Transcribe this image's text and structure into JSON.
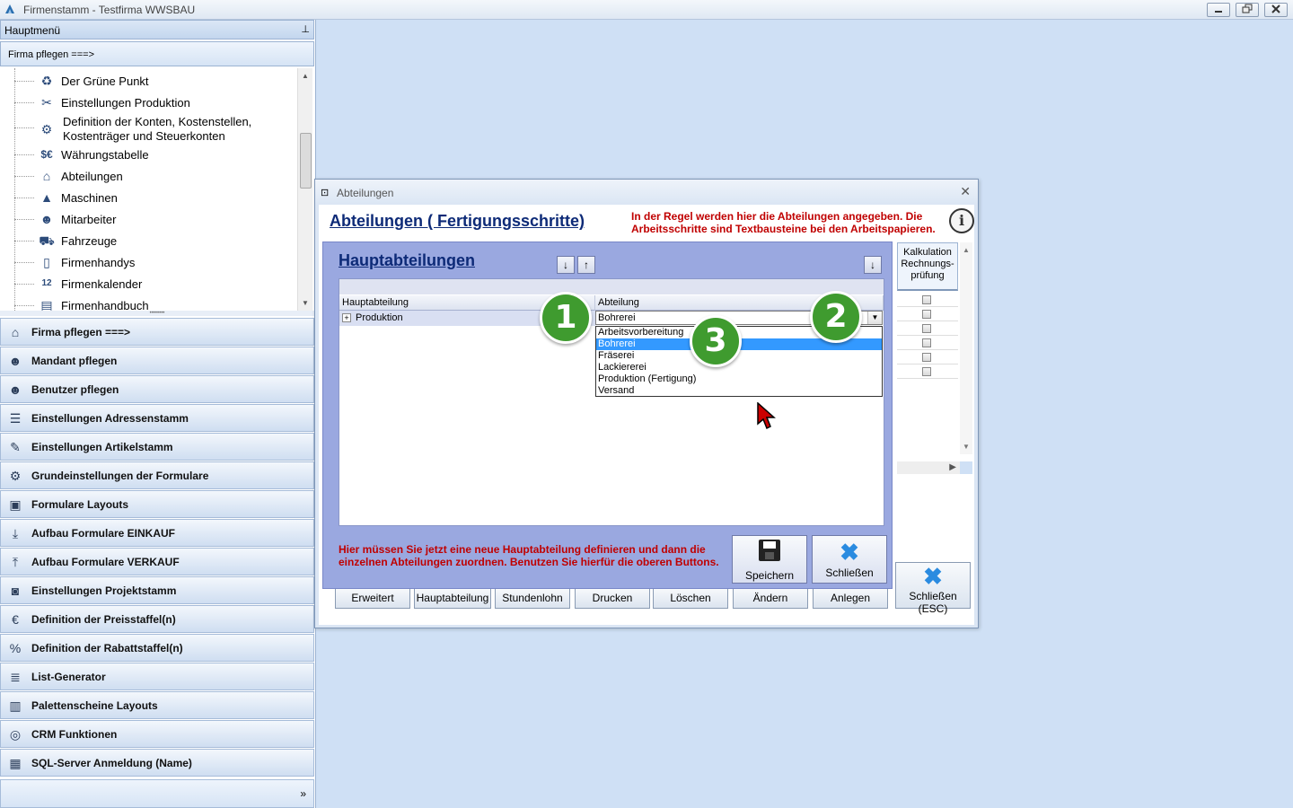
{
  "window": {
    "title": "Firmenstamm - Testfirma WWSBAU",
    "min": "▭",
    "restore": "⧉",
    "close": "✕"
  },
  "left_panel": {
    "header": "Hauptmenü",
    "pin": "⊥",
    "subheader": "Firma pflegen    ===>",
    "tree_items": [
      {
        "label": "Der Grüne Punkt",
        "icon": "recycle-icon",
        "glyph": "♻"
      },
      {
        "label": "Einstellungen Produktion",
        "icon": "tools-icon",
        "glyph": "✂"
      },
      {
        "label": "Definition der Konten, Kostenstellen,",
        "label2": "Kostenträger und Steuerkonten",
        "icon": "accounts-icon",
        "glyph": "⚙"
      },
      {
        "label": "Währungstabelle",
        "icon": "currency-icon",
        "glyph": "$€"
      },
      {
        "label": "Abteilungen",
        "icon": "departments-icon",
        "glyph": "⌂"
      },
      {
        "label": "Maschinen",
        "icon": "machines-icon",
        "glyph": "▲"
      },
      {
        "label": "Mitarbeiter",
        "icon": "employees-icon",
        "glyph": "☻"
      },
      {
        "label": "Fahrzeuge",
        "icon": "car-icon",
        "glyph": "⛟"
      },
      {
        "label": "Firmenhandys",
        "icon": "phone-icon",
        "glyph": "▯"
      },
      {
        "label": "Firmenkalender",
        "icon": "calendar-icon",
        "glyph": "12"
      },
      {
        "label": "Firmenhandbuch",
        "icon": "book-icon",
        "glyph": "▤"
      }
    ],
    "nav_buttons": [
      {
        "label": "Firma pflegen   ===>",
        "icon": "factory-icon",
        "glyph": "⌂"
      },
      {
        "label": "Mandant pflegen",
        "icon": "client-icon",
        "glyph": "☻"
      },
      {
        "label": "Benutzer pflegen",
        "icon": "users-icon",
        "glyph": "☻"
      },
      {
        "label": "Einstellungen Adressenstamm",
        "icon": "address-icon",
        "glyph": "☰"
      },
      {
        "label": "Einstellungen Artikelstamm",
        "icon": "article-icon",
        "glyph": "✎"
      },
      {
        "label": "Grundeinstellungen der Formulare",
        "icon": "form-settings-icon",
        "glyph": "⚙"
      },
      {
        "label": "Formulare Layouts",
        "icon": "form-layout-icon",
        "glyph": "▣"
      },
      {
        "label": "Aufbau Formulare EINKAUF",
        "icon": "download-tray-icon",
        "glyph": "⤓"
      },
      {
        "label": "Aufbau Formulare VERKAUF",
        "icon": "upload-tray-icon",
        "glyph": "⤒"
      },
      {
        "label": "Einstellungen Projektstamm",
        "icon": "project-icon",
        "glyph": "◙"
      },
      {
        "label": "Definition der Preisstaffel(n)",
        "icon": "price-icon",
        "glyph": "€"
      },
      {
        "label": "Definition der Rabattstaffel(n)",
        "icon": "discount-icon",
        "glyph": "%"
      },
      {
        "label": "List-Generator",
        "icon": "list-icon",
        "glyph": "≣"
      },
      {
        "label": "Palettenscheine Layouts",
        "icon": "pallet-icon",
        "glyph": "▥"
      },
      {
        "label": "CRM Funktionen",
        "icon": "crm-icon",
        "glyph": "◎"
      },
      {
        "label": "SQL-Server Anmeldung (Name)",
        "icon": "server-icon",
        "glyph": "▦"
      }
    ],
    "footer_glyph": "»"
  },
  "outer_dialog": {
    "title": "Abteilungen",
    "heading": "Abteilungen ( Fertigungsschritte)",
    "hint": "In der Regel werden hier die Abteilungen angegeben. Die Arbeitsschritte sind Textbausteine bei den Arbeitspapieren.",
    "kalk_header": "Kalkulation Rechnungs-prüfung",
    "buttons": [
      "Erweitert",
      "Hauptabteilung",
      "Stundenlohn",
      "Drucken",
      "Löschen",
      "Ändern",
      "Anlegen"
    ],
    "close_button": "Schließen (ESC)"
  },
  "inner_dialog": {
    "heading": "Hauptabteilungen",
    "col_main": "Hauptabteilung",
    "col_dept": "Abteilung",
    "row_main": "Produktion",
    "combo_value": "Bohrerei",
    "options": [
      "Arbeitsvorbereitung",
      "Bohrerei",
      "Fräserei",
      "Lackiererei",
      "Produktion (Fertigung)",
      "Versand"
    ],
    "selected_option": "Bohrerei",
    "hint": "Hier müssen Sie jetzt eine neue Hauptabteilung definieren und dann die einzelnen Abteilungen zuordnen. Benutzen Sie hierfür die oberen Buttons.",
    "save": "Speichern",
    "close": "Schließen"
  },
  "markers": [
    "1",
    "2",
    "3"
  ]
}
